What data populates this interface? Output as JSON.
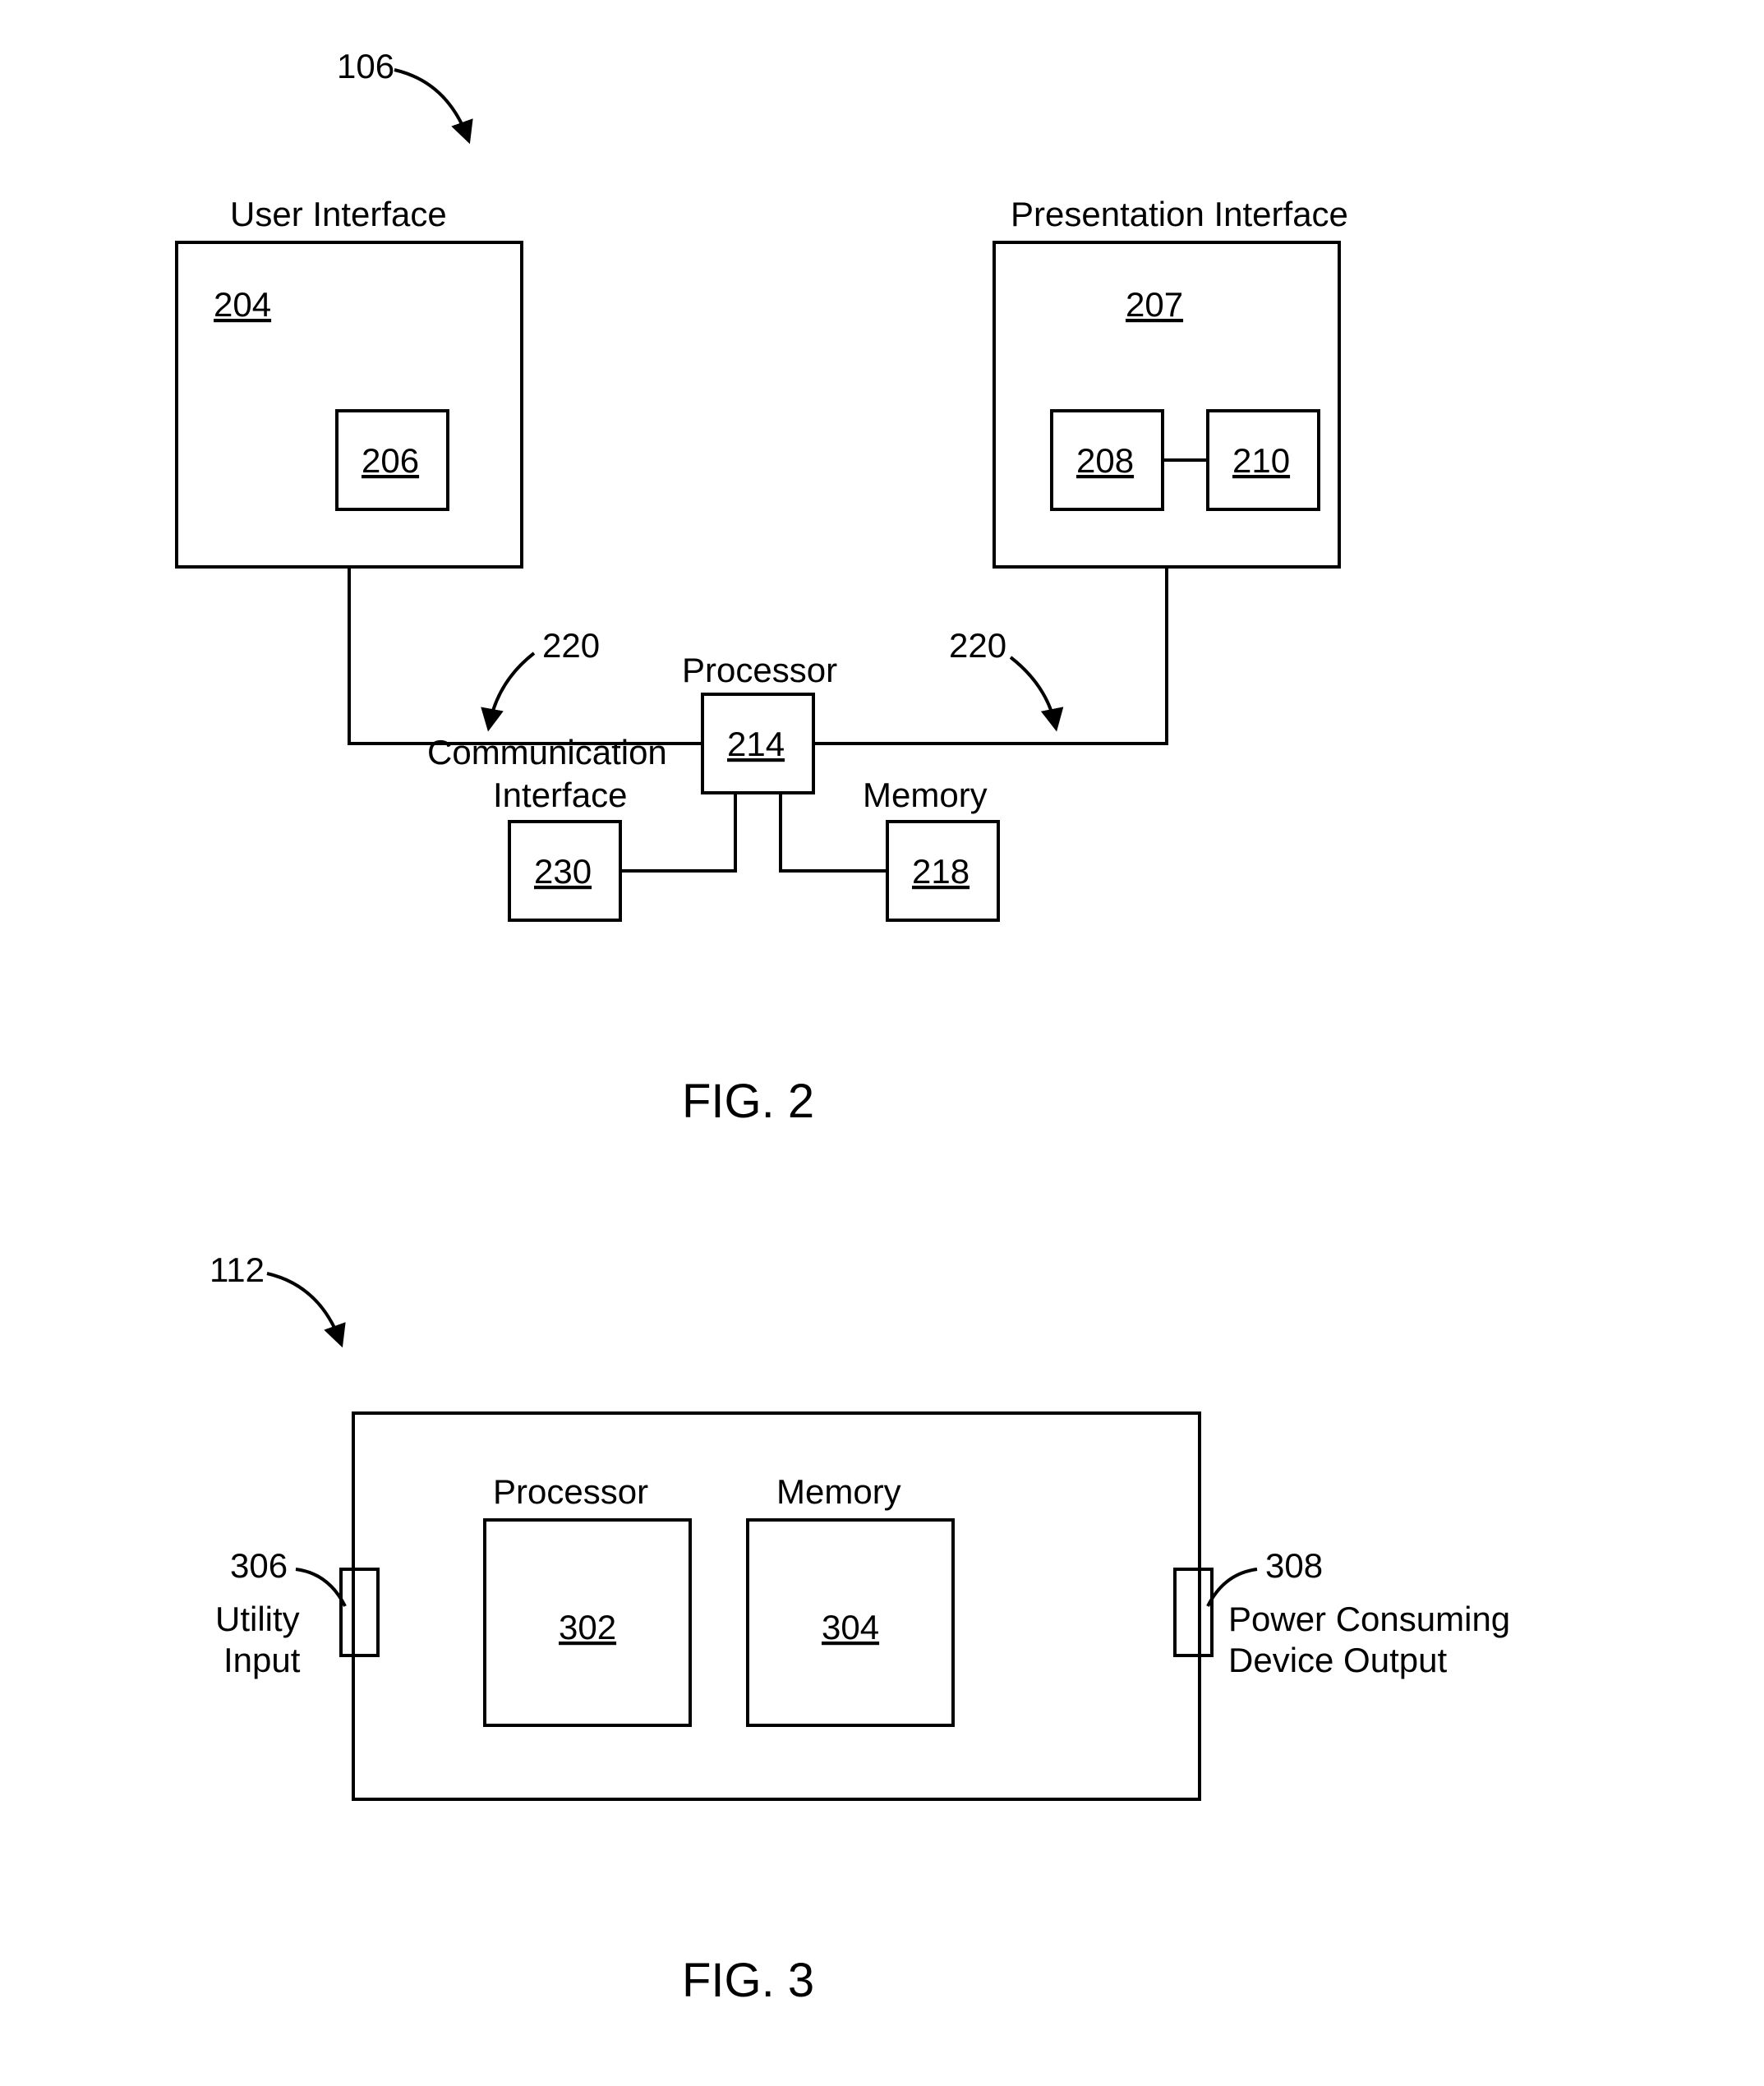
{
  "fig2": {
    "pointer": "106",
    "userInterface": {
      "title": "User Interface",
      "ref": "204",
      "child": "206"
    },
    "presentationInterface": {
      "title": "Presentation Interface",
      "ref": "207",
      "childLeft": "208",
      "childRight": "210"
    },
    "leftConnector": "220",
    "rightConnector": "220",
    "processor": {
      "title": "Processor",
      "ref": "214"
    },
    "commInterface": {
      "title1": "Communication",
      "title2": "Interface",
      "ref": "230"
    },
    "memory": {
      "title": "Memory",
      "ref": "218"
    },
    "caption": "FIG. 2"
  },
  "fig3": {
    "pointer": "112",
    "leftPort": {
      "ref": "306",
      "label1": "Utility",
      "label2": "Input"
    },
    "rightPort": {
      "ref": "308",
      "label1": "Power Consuming",
      "label2": "Device Output"
    },
    "processor": {
      "title": "Processor",
      "ref": "302"
    },
    "memory": {
      "title": "Memory",
      "ref": "304"
    },
    "caption": "FIG. 3"
  }
}
